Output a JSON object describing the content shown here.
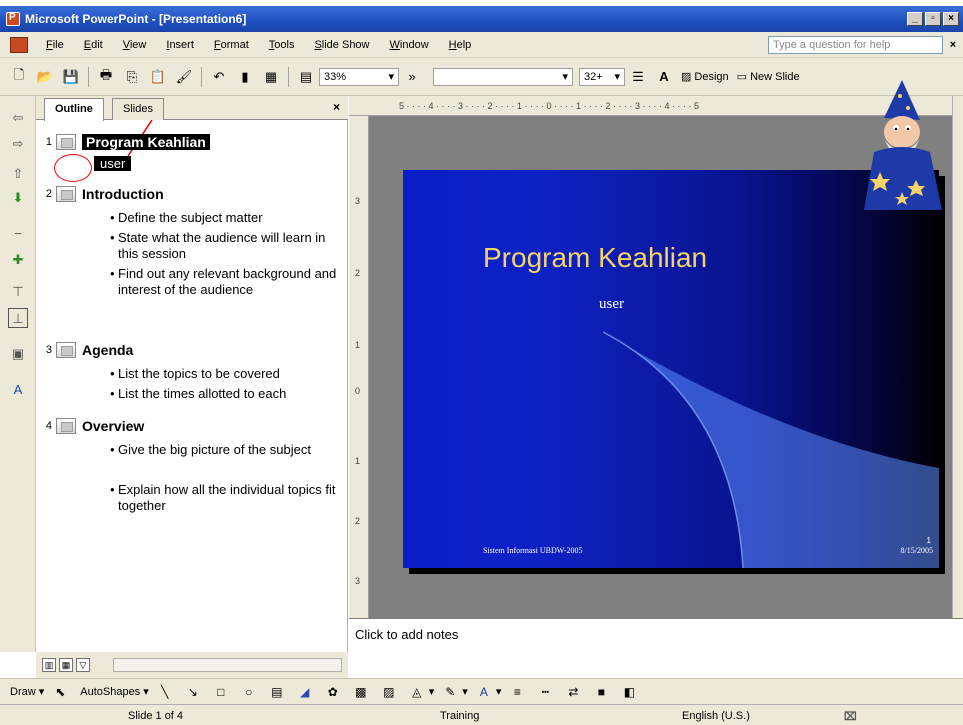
{
  "window": {
    "title": "Microsoft PowerPoint - [Presentation6]",
    "minimize": "_",
    "restore": "▫",
    "close": "×"
  },
  "menu": {
    "items": [
      "File",
      "Edit",
      "View",
      "Insert",
      "Format",
      "Tools",
      "Slide Show",
      "Window",
      "Help"
    ],
    "help_placeholder": "Type a question for help",
    "close": "×"
  },
  "toolbar": {
    "zoom": "33%",
    "font_size": "32+",
    "design_label": "Design",
    "new_slide_label": "New Slide"
  },
  "outline_pane": {
    "tabs": [
      "Outline",
      "Slides"
    ],
    "close": "×",
    "slides": [
      {
        "num": "1",
        "title": "Program Keahlian",
        "subtitle": "user",
        "bullets": []
      },
      {
        "num": "2",
        "title": "Introduction",
        "bullets": [
          "Define the subject matter",
          "State what the audience will learn in this session",
          "Find out any relevant background and interest of the audience"
        ]
      },
      {
        "num": "3",
        "title": "Agenda",
        "bullets": [
          "List the topics to be covered",
          "List the times allotted to each"
        ]
      },
      {
        "num": "4",
        "title": "Overview",
        "bullets": [
          "Give the big picture of the subject",
          "Explain how all the individual topics fit together"
        ]
      }
    ]
  },
  "slide": {
    "title": "Program Keahlian",
    "subtitle": "user",
    "footer": "Sistem Informasi UBDW-2005",
    "date": "8/15/2005",
    "number": "1"
  },
  "notes": {
    "placeholder": "Click to add notes"
  },
  "drawing_toolbar": {
    "draw": "Draw",
    "autoshapes": "AutoShapes"
  },
  "status": {
    "slide": "Slide 1 of 4",
    "design": "Training",
    "language": "English (U.S.)"
  },
  "colors": {
    "title_bar": "#1f4fbf",
    "slide_title": "#f5d36a",
    "annotation": "#e00000"
  }
}
